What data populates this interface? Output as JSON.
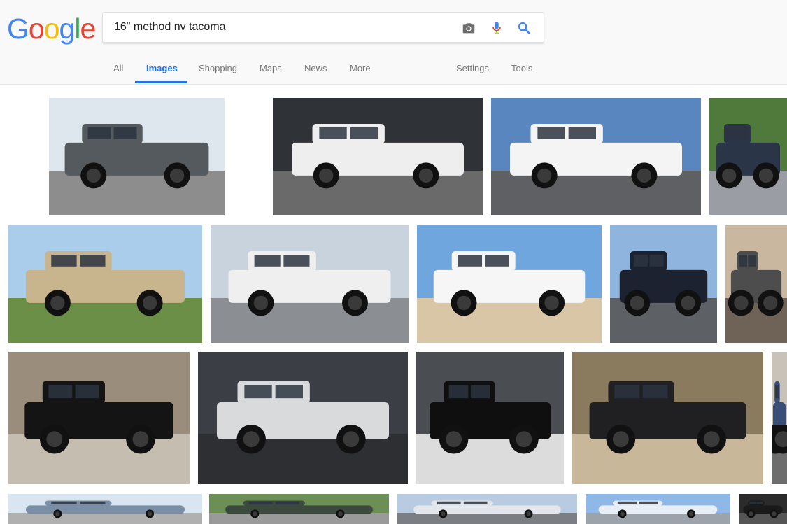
{
  "logo": {
    "letters": [
      "G",
      "o",
      "o",
      "g",
      "l",
      "e"
    ],
    "colors": [
      "#4285F4",
      "#EA4335",
      "#FBBC05",
      "#4285F4",
      "#34A853",
      "#EA4335"
    ]
  },
  "search": {
    "query": "16\" method nv tacoma"
  },
  "icons": {
    "camera": "camera-icon",
    "mic": "microphone-icon",
    "search": "search-icon"
  },
  "tabs": {
    "all": "All",
    "images": "Images",
    "shopping": "Shopping",
    "maps": "Maps",
    "news": "News",
    "more": "More",
    "settings": "Settings",
    "tools": "Tools"
  },
  "colors": {
    "accent": "#1a73e8"
  },
  "results": [
    {
      "truck": "#555a5f",
      "sky": "#dfe7ee",
      "ground": "#8d8d8d"
    },
    {
      "truck": "#eeeeee",
      "sky": "#2f3236",
      "ground": "#6a6a6a"
    },
    {
      "truck": "#f4f4f4",
      "sky": "#5a86c0",
      "ground": "#5f6064"
    },
    {
      "truck": "#2a3548",
      "sky": "#4f7a3c",
      "ground": "#9a9ea4"
    },
    {
      "truck": "#c8b58e",
      "sky": "#a9cdeb",
      "ground": "#6b8f46"
    },
    {
      "truck": "#efefef",
      "sky": "#c9d3dd",
      "ground": "#8b8f93"
    },
    {
      "truck": "#f6f6f6",
      "sky": "#6fa6de",
      "ground": "#d8c6a6"
    },
    {
      "truck": "#1c2230",
      "sky": "#8fb4de",
      "ground": "#5d6166"
    },
    {
      "truck": "#4d4d4d",
      "sky": "#c9b7a0",
      "ground": "#6f6257"
    },
    {
      "truck": "#141414",
      "sky": "#9a8d7c",
      "ground": "#c4bdb0"
    },
    {
      "truck": "#d9dadc",
      "sky": "#3b3f45",
      "ground": "#2e2f33"
    },
    {
      "truck": "#0f0f10",
      "sky": "#4a4d52",
      "ground": "#dcdcdc"
    },
    {
      "truck": "#202022",
      "sky": "#8a7a5e",
      "ground": "#c9b79a"
    },
    {
      "truck": "#3a4f78",
      "sky": "#c9c2b8",
      "ground": "#6d6d6d"
    },
    {
      "truck": "#7a8fa6",
      "sky": "#d9e6f2",
      "ground": "#b0b0b0"
    },
    {
      "truck": "#3b4a3c",
      "sky": "#6c8f55",
      "ground": "#9a9a9a"
    },
    {
      "truck": "#e3e6ea",
      "sky": "#b8cbe0",
      "ground": "#7b7f84"
    },
    {
      "truck": "#e8eef6",
      "sky": "#8db8e8",
      "ground": "#9da3aa"
    },
    {
      "truck": "#1a1a1a",
      "sky": "#2b2b2b",
      "ground": "#555555"
    }
  ]
}
